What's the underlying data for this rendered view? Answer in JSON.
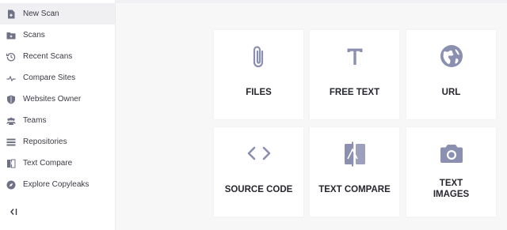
{
  "sidebar": {
    "items": [
      {
        "label": "New Scan",
        "icon": "new-scan-icon",
        "active": true
      },
      {
        "label": "Scans",
        "icon": "folder-icon"
      },
      {
        "label": "Recent Scans",
        "icon": "history-icon"
      },
      {
        "label": "Compare Sites",
        "icon": "compare-sites-icon"
      },
      {
        "label": "Websites Owner",
        "icon": "shield-icon"
      },
      {
        "label": "Teams",
        "icon": "team-icon"
      },
      {
        "label": "Repositories",
        "icon": "list-icon"
      },
      {
        "label": "Text Compare",
        "icon": "compare-icon"
      },
      {
        "label": "Explore Copyleaks",
        "icon": "compass-icon"
      }
    ],
    "collapse_icon": "collapse-sidebar-icon"
  },
  "scan_options": [
    {
      "label": "FILES",
      "icon": "paperclip-icon"
    },
    {
      "label": "FREE TEXT",
      "icon": "text-icon"
    },
    {
      "label": "URL",
      "icon": "globe-icon"
    },
    {
      "label": "SOURCE CODE",
      "icon": "code-icon"
    },
    {
      "label": "TEXT COMPARE",
      "icon": "compare-icon"
    },
    {
      "label": "TEXT\nIMAGES",
      "icon": "camera-icon"
    }
  ],
  "colors": {
    "icon": "#8b8fb0",
    "sidebar_icon": "#6f7285",
    "text": "#26262f",
    "active_bg": "#f0f0f3"
  }
}
